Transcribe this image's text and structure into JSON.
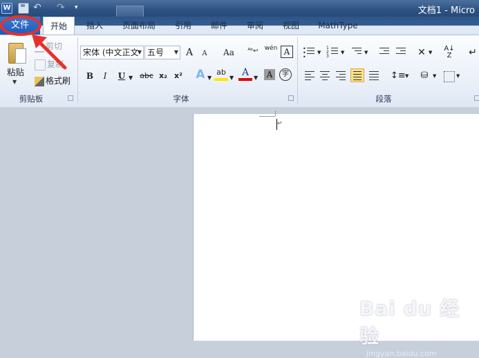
{
  "window": {
    "title": "文档1 - Micro"
  },
  "quick_access": {
    "app_icon": "word-icon",
    "save": "save-icon",
    "undo": "undo-icon",
    "redo": "redo-icon",
    "customize": "qat-more-icon"
  },
  "tabs": {
    "file": "文件",
    "home": "开始",
    "insert": "插入",
    "layout": "页面布局",
    "references": "引用",
    "mailings": "邮件",
    "review": "审阅",
    "view": "视图",
    "mathtype": "MathType"
  },
  "clipboard": {
    "paste": "粘贴",
    "cut": "剪切",
    "copy": "复制",
    "format_painter": "格式刷",
    "group_label": "剪贴板"
  },
  "font": {
    "font_name": "宋体 (中文正文",
    "font_size": "五号",
    "group_label": "字体",
    "bold": "B",
    "italic": "I",
    "underline": "U",
    "strike": "abc",
    "subscript": "x₂",
    "superscript": "x²",
    "grow": "A",
    "shrink": "A",
    "change_case": "Aa",
    "phonetic": "wén",
    "char_border": "A",
    "text_effect": "A",
    "highlight": "ab",
    "font_color": "A",
    "char_shading": "A",
    "enclose": "字"
  },
  "paragraph": {
    "group_label": "段落"
  },
  "colors": {
    "file_tab": "#2a6acb",
    "annotation": "#e8302c",
    "highlight_yellow": "#ffe600",
    "font_red": "#e00000"
  },
  "watermark": {
    "brand": "Bai du 经验",
    "url": "jingyan.baidu.com"
  }
}
